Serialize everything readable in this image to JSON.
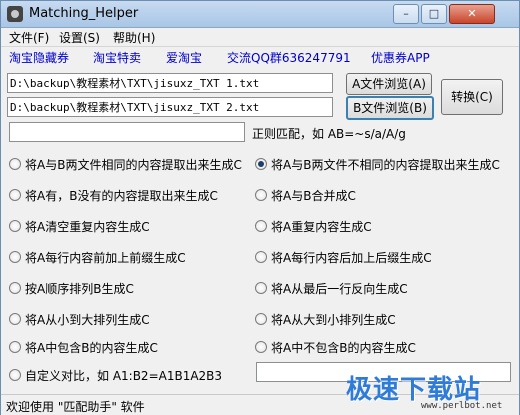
{
  "window": {
    "title": "Matching_Helper",
    "minimize_glyph": "–",
    "maximize_glyph": "□",
    "close_glyph": "✕",
    "app_icon": "app-logo-icon"
  },
  "menu": {
    "items": [
      "文件(F)",
      "设置(S)",
      "帮助(H)"
    ]
  },
  "links": [
    "淘宝隐藏券",
    "淘宝特卖",
    "爱淘宝",
    "交流QQ群636247791",
    "优惠券APP"
  ],
  "files": {
    "path_a": "D:\\backup\\教程素材\\TXT\\jisuxz_TXT 1.txt",
    "path_b": "D:\\backup\\教程素材\\TXT\\jisuxz_TXT 2.txt",
    "browse_a_label": "A文件浏览(A)",
    "browse_b_label": "B文件浏览(B)",
    "convert_label": "转换(C)"
  },
  "regex": {
    "value": "",
    "label": "正则匹配，如 AB=~s/a/A/g"
  },
  "options": {
    "left": [
      {
        "label": "将A与B两文件相同的内容提取出来生成C",
        "checked": false
      },
      {
        "label": "将A有，B没有的内容提取出来生成C",
        "checked": false
      },
      {
        "label": "将A清空重复内容生成C",
        "checked": false
      },
      {
        "label": "将A每行内容前加上前缀生成C",
        "checked": false
      },
      {
        "label": "按A顺序排列B生成C",
        "checked": false
      },
      {
        "label": "将A从小到大排列生成C",
        "checked": false
      },
      {
        "label": "将A中包含B的内容生成C",
        "checked": false
      },
      {
        "label": "自定义对比，如 A1:B2=A1B1A2B3",
        "checked": false
      }
    ],
    "right": [
      {
        "label": "将A与B两文件不相同的内容提取出来生成C",
        "checked": true
      },
      {
        "label": "将A与B合并成C",
        "checked": false
      },
      {
        "label": "将A重复内容生成C",
        "checked": false
      },
      {
        "label": "将A每行内容后加上后缀生成C",
        "checked": false
      },
      {
        "label": "将A从最后一行反向生成C",
        "checked": false
      },
      {
        "label": "将A从大到小排列生成C",
        "checked": false
      },
      {
        "label": "将A中不包含B的内容生成C",
        "checked": false
      }
    ],
    "custom_value": ""
  },
  "status": {
    "text": "欢迎使用 \"匹配助手\" 软件"
  },
  "watermark": {
    "brand": "极速下载站",
    "url": "www.perlbot.net"
  },
  "colors": {
    "link": "#0000cc",
    "title_bar": "#a9c6e6",
    "close_button": "#c9452c",
    "watermark": "#2f7bd8"
  }
}
